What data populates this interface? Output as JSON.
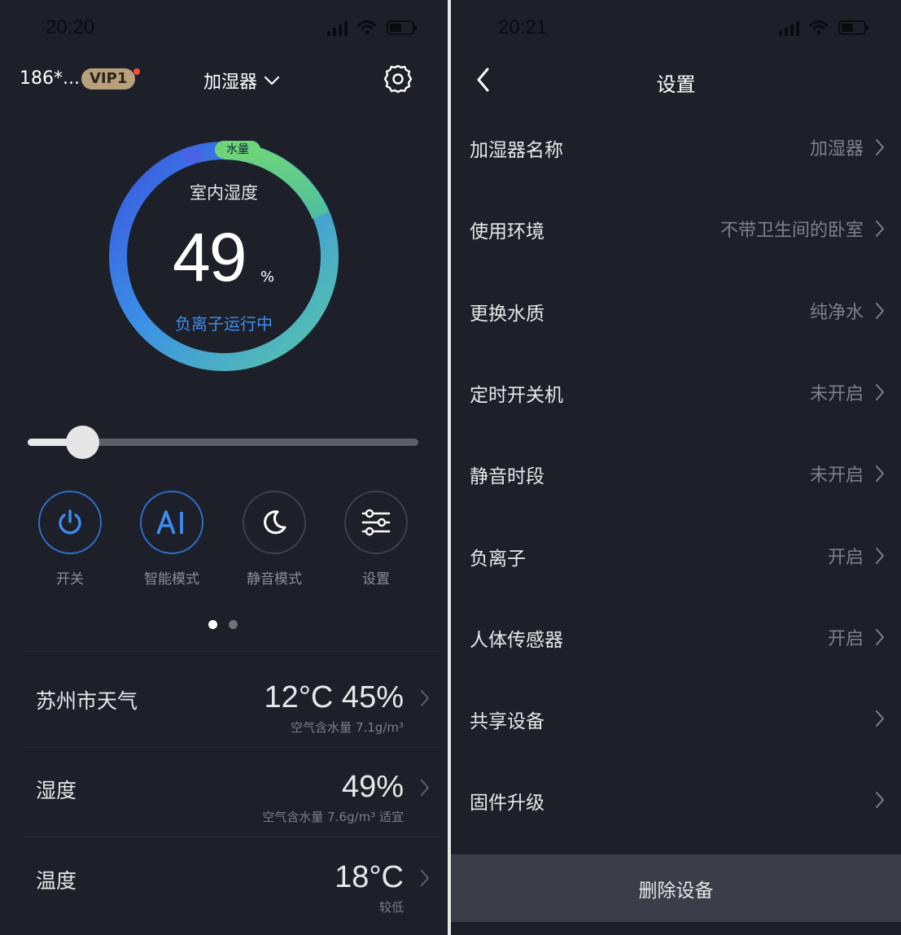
{
  "left": {
    "status_time": "20:20",
    "account": "186*...",
    "vip_badge": "VIP1",
    "device_name": "加湿器",
    "gauge": {
      "water_badge": "水量",
      "title": "室内湿度",
      "value": "49",
      "unit": "%",
      "status": "负离子运行中"
    },
    "slider": {
      "level": 0.14
    },
    "modes": [
      {
        "label": "开关",
        "icon": "power-icon",
        "active": true
      },
      {
        "label": "智能模式",
        "icon": "ai-icon",
        "active": true
      },
      {
        "label": "静音模式",
        "icon": "moon-icon",
        "active": false
      },
      {
        "label": "设置",
        "icon": "sliders-icon",
        "active": false
      }
    ],
    "pager": {
      "pages": 2,
      "current": 1
    },
    "info": [
      {
        "name": "苏州市天气",
        "value": "12°C 45%",
        "sub": "空气含水量  7.1g/m³"
      },
      {
        "name": "湿度",
        "value": "49%",
        "sub": "空气含水量 7.6g/m³ 适宜"
      },
      {
        "name": "温度",
        "value": "18°C",
        "sub": "较低"
      }
    ]
  },
  "right": {
    "status_time": "20:21",
    "title": "设置",
    "rows": [
      {
        "label": "加湿器名称",
        "value": "加湿器"
      },
      {
        "label": "使用环境",
        "value": "不带卫生间的卧室"
      },
      {
        "label": "更换水质",
        "value": "纯净水"
      },
      {
        "label": "定时开关机",
        "value": "未开启"
      },
      {
        "label": "静音时段",
        "value": "未开启"
      },
      {
        "label": "负离子",
        "value": "开启"
      },
      {
        "label": "人体传感器",
        "value": "开启"
      },
      {
        "label": "共享设备",
        "value": ""
      },
      {
        "label": "固件升级",
        "value": ""
      }
    ],
    "delete_label": "删除设备"
  },
  "colors": {
    "background": "#1d2029",
    "accent_blue": "#3d8cf0",
    "gauge_green": "#6ed47a",
    "vip_gold": "#b8a07a",
    "delete_bg": "#3b3e48"
  }
}
